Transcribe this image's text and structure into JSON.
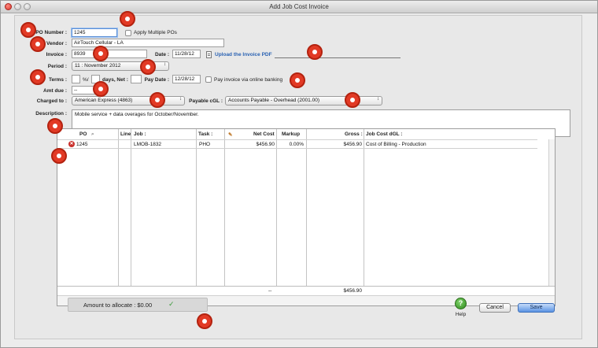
{
  "window": {
    "title": "Add Job Cost Invoice"
  },
  "form": {
    "po_label": "PO Number :",
    "po_value": "1245",
    "apply_multiple_label": "Apply Multiple POs",
    "vendor_label": "Vendor :",
    "vendor_value": "AirTouch Cellular - LA",
    "invoice_label": "Invoice :",
    "invoice_value": "8939",
    "date_label": "Date :",
    "date_value": "11/28/12",
    "upload_link": "Upload the Invoice PDF",
    "period_label": "Period :",
    "period_value": "11 : November 2012",
    "terms_label": "Terms :",
    "terms_percent_suffix": "%/",
    "terms_days_suffix": "days, Net :",
    "pay_date_label": "Pay Date :",
    "pay_date_value": "12/28/12",
    "online_banking_label": "Pay invoice via online banking",
    "amt_due_label": "Amt due :",
    "amt_due_value": "--",
    "charged_to_label": "Charged to :",
    "charged_to_value": "American Express (4863)",
    "payable_cgl_label": "Payable cGL :",
    "payable_cgl_value": "Accounts Payable - Overhead (2001.00)",
    "description_label": "Description :",
    "description_value": "Mobile service + data overages for October/November."
  },
  "table": {
    "headers": {
      "po": "PO",
      "line": "Line",
      "job": "Job :",
      "task": "Task :",
      "net_cost": "Net Cost",
      "markup": "Markup",
      "gross": "Gross :",
      "job_cost_dgl": "Job Cost dGL :"
    },
    "rows": [
      {
        "po": "1245",
        "line": "",
        "job": "LMOB-1832",
        "task": "PHO",
        "net_cost": "$456.90",
        "markup": "0.00%",
        "gross": "$456.90",
        "job_cost_dgl": "Cost of Billing - Production"
      }
    ],
    "totals": {
      "markup": "--",
      "gross": "$456.90"
    }
  },
  "footer": {
    "amount_to_allocate": "Amount to allocate :  $0.00",
    "help_label": "Help",
    "cancel_label": "Cancel",
    "save_label": "Save"
  },
  "icons": {
    "marker": "red-circle-marker",
    "help": "help-icon",
    "delete_row": "delete-row-icon",
    "search": "search-icon",
    "pencil": "pencil-icon",
    "document": "document-icon",
    "checkmark": "checkmark-icon"
  },
  "colors": {
    "marker": "#e23a25",
    "link": "#2b63b3",
    "save_button": "#5b93e3",
    "allocate_check": "#3a9b3a"
  }
}
